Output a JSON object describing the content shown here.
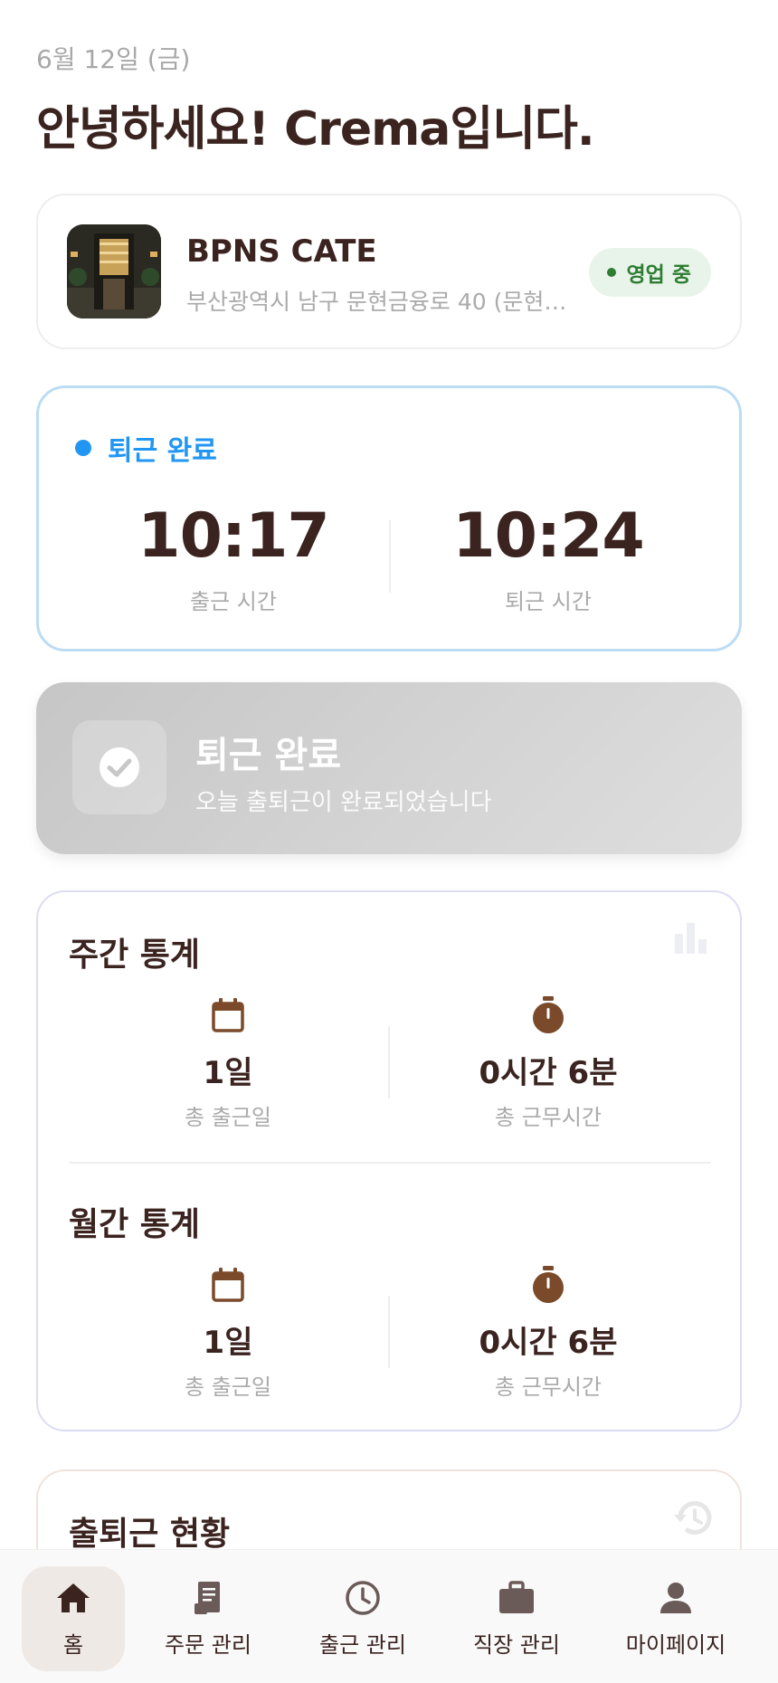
{
  "header": {
    "date": "6월 12일 (금)",
    "greeting": "안녕하세요! Crema입니다."
  },
  "store": {
    "name": "BPNS CATE",
    "address": "부산광역시 남구 문현금융로 40 (문현…",
    "status": "영업 중"
  },
  "attendance": {
    "status": "퇴근 완료",
    "clock_in_time": "10:17",
    "clock_in_label": "출근 시간",
    "clock_out_time": "10:24",
    "clock_out_label": "퇴근 시간"
  },
  "done_banner": {
    "title": "퇴근 완료",
    "subtitle": "오늘 출퇴근이 완료되었습니다"
  },
  "stats": {
    "weekly": {
      "title": "주간 통계",
      "days_value": "1일",
      "days_label": "총 출근일",
      "hours_value": "0시간 6분",
      "hours_label": "총 근무시간"
    },
    "monthly": {
      "title": "월간 통계",
      "days_value": "1일",
      "days_label": "총 출근일",
      "hours_value": "0시간 6분",
      "hours_label": "총 근무시간"
    }
  },
  "history": {
    "title": "출퇴근 현황"
  },
  "nav": {
    "items": [
      {
        "label": "홈",
        "icon": "home-icon"
      },
      {
        "label": "주문 관리",
        "icon": "receipt-icon"
      },
      {
        "label": "출근 관리",
        "icon": "clock-icon"
      },
      {
        "label": "직장 관리",
        "icon": "briefcase-icon"
      },
      {
        "label": "마이페이지",
        "icon": "person-icon"
      }
    ]
  },
  "colors": {
    "primary_text": "#3b2420",
    "accent_blue": "#2196f3",
    "status_green": "#2e7d32",
    "icon_brown": "#7a4a2a"
  }
}
